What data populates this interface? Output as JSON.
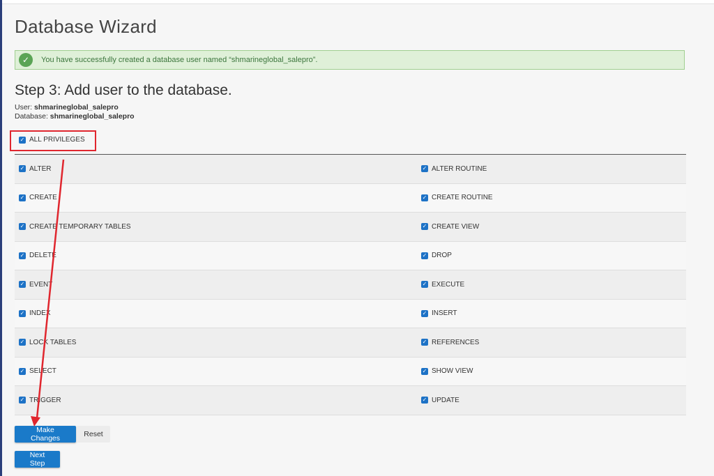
{
  "page": {
    "title": "Database Wizard"
  },
  "alert": {
    "icon": "check-circle-icon",
    "message": "You have successfully created a database user named “shmarineglobal_salepro”."
  },
  "step": {
    "title": "Step 3: Add user to the database.",
    "user_label": "User:",
    "user_value": "shmarineglobal_salepro",
    "database_label": "Database:",
    "database_value": "shmarineglobal_salepro"
  },
  "all_privileges": {
    "label": "ALL PRIVILEGES",
    "checked": true
  },
  "privileges": [
    {
      "left": "ALTER",
      "right": "ALTER ROUTINE"
    },
    {
      "left": "CREATE",
      "right": "CREATE ROUTINE"
    },
    {
      "left": "CREATE TEMPORARY TABLES",
      "right": "CREATE VIEW"
    },
    {
      "left": "DELETE",
      "right": "DROP"
    },
    {
      "left": "EVENT",
      "right": "EXECUTE"
    },
    {
      "left": "INDEX",
      "right": "INSERT"
    },
    {
      "left": "LOCK TABLES",
      "right": "REFERENCES"
    },
    {
      "left": "SELECT",
      "right": "SHOW VIEW"
    },
    {
      "left": "TRIGGER",
      "right": "UPDATE"
    }
  ],
  "buttons": {
    "make_changes": "Make Changes",
    "reset": "Reset",
    "next_step": "Next Step"
  },
  "colors": {
    "accent": "#1a7ac9",
    "success_bg": "#dff0d8",
    "annotation": "#e0262e"
  }
}
